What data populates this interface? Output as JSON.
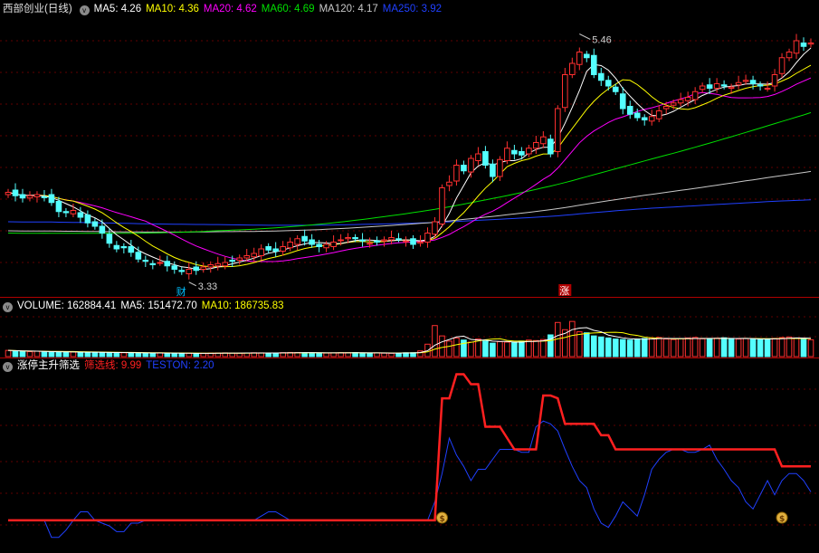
{
  "main": {
    "title": "西部创业(日线)",
    "ma": [
      {
        "label": "MA5: 4.26",
        "color": "#ffffff"
      },
      {
        "label": "MA10: 4.36",
        "color": "#ffff00"
      },
      {
        "label": "MA20: 4.62",
        "color": "#ff00ff"
      },
      {
        "label": "MA60: 4.69",
        "color": "#00e000"
      },
      {
        "label": "MA120: 4.17",
        "color": "#c8c8c8"
      },
      {
        "label": "MA250: 3.92",
        "color": "#2040ff"
      }
    ],
    "high_label": "5.46",
    "low_label": "3.33",
    "marker_cai": "财",
    "marker_zhang": "涨"
  },
  "volume": {
    "items": [
      {
        "label": "VOLUME: 162884.41",
        "color": "#ffffff"
      },
      {
        "label": "MA5: 151472.70",
        "color": "#ffffff"
      },
      {
        "label": "MA10: 186735.83",
        "color": "#ffff00"
      }
    ]
  },
  "indicator": {
    "items": [
      {
        "label": "涨停主升筛选",
        "color": "#ffffff"
      },
      {
        "label": "筛选线: 9.99",
        "color": "#ff2020"
      },
      {
        "label": "TESTON: 2.20",
        "color": "#2040ff"
      }
    ]
  },
  "chart_data": [
    {
      "type": "candlestick",
      "title": "西部创业(日线)",
      "ylim": [
        3.2,
        5.6
      ],
      "x": [
        1,
        2,
        3,
        4,
        5,
        6,
        7,
        8,
        9,
        10,
        11,
        12,
        13,
        14,
        15,
        16,
        17,
        18,
        19,
        20,
        21,
        22,
        23,
        24,
        25,
        26,
        27,
        28,
        29,
        30,
        31,
        32,
        33,
        34,
        35,
        36,
        37,
        38,
        39,
        40,
        41,
        42,
        43,
        44,
        45,
        46,
        47,
        48,
        49,
        50,
        51,
        52,
        53,
        54,
        55,
        56,
        57,
        58,
        59,
        60,
        61,
        62,
        63,
        64,
        65,
        66,
        67,
        68,
        69,
        70,
        71,
        72,
        73,
        74,
        75,
        76,
        77,
        78,
        79,
        80,
        81,
        82,
        83,
        84,
        85,
        86,
        87,
        88,
        89,
        90,
        91,
        92,
        93,
        94,
        95,
        96,
        97,
        98,
        99,
        100,
        101,
        102,
        103,
        104,
        105,
        106,
        107,
        108,
        109,
        110,
        111,
        112
      ],
      "close": [
        4.06,
        4.03,
        4.01,
        4.03,
        4.04,
        4.02,
        3.97,
        3.89,
        3.88,
        3.9,
        3.84,
        3.79,
        3.76,
        3.7,
        3.61,
        3.56,
        3.57,
        3.53,
        3.47,
        3.45,
        3.42,
        3.44,
        3.41,
        3.38,
        3.36,
        3.38,
        3.37,
        3.4,
        3.42,
        3.43,
        3.44,
        3.45,
        3.48,
        3.5,
        3.52,
        3.56,
        3.55,
        3.54,
        3.58,
        3.62,
        3.65,
        3.63,
        3.6,
        3.58,
        3.6,
        3.62,
        3.64,
        3.66,
        3.65,
        3.63,
        3.61,
        3.62,
        3.64,
        3.66,
        3.65,
        3.63,
        3.6,
        3.62,
        3.7,
        3.8,
        4.1,
        4.15,
        4.3,
        4.25,
        4.36,
        4.4,
        4.3,
        4.2,
        4.35,
        4.45,
        4.4,
        4.39,
        4.45,
        4.5,
        4.55,
        4.4,
        4.8,
        5.1,
        5.2,
        5.3,
        5.25,
        5.1,
        5.05,
        5.0,
        4.95,
        4.8,
        4.75,
        4.72,
        4.7,
        4.73,
        4.78,
        4.82,
        4.85,
        4.88,
        4.9,
        4.95,
        5.0,
        4.98,
        5.02,
        5.0,
        4.99,
        5.03,
        5.05,
        5.02,
        5.0,
        4.98,
        5.1,
        5.25,
        5.3,
        5.4,
        5.35,
        5.38
      ],
      "high_marker": 5.46,
      "low_marker": 3.33,
      "moving_averages": [
        {
          "name": "MA5",
          "last": 4.26
        },
        {
          "name": "MA10",
          "last": 4.36
        },
        {
          "name": "MA20",
          "last": 4.62
        },
        {
          "name": "MA60",
          "last": 4.69
        },
        {
          "name": "MA120",
          "last": 4.17
        },
        {
          "name": "MA250",
          "last": 3.92
        }
      ]
    },
    {
      "type": "bar",
      "title": "VOLUME",
      "ylim": [
        0,
        420000
      ],
      "values": [
        60000,
        55000,
        50000,
        48000,
        52000,
        45000,
        46000,
        44000,
        43000,
        45000,
        42000,
        40000,
        41000,
        39000,
        38000,
        40000,
        37000,
        36000,
        35000,
        34000,
        33000,
        36000,
        34000,
        32000,
        31000,
        33000,
        30000,
        32000,
        34000,
        35000,
        36000,
        34000,
        33000,
        35000,
        37000,
        36000,
        34000,
        35000,
        38000,
        40000,
        39000,
        37000,
        36000,
        35000,
        34000,
        36000,
        38000,
        37000,
        39000,
        35000,
        34000,
        36000,
        33000,
        32000,
        35000,
        37000,
        38000,
        55000,
        120000,
        300000,
        200000,
        150000,
        180000,
        160000,
        140000,
        170000,
        150000,
        130000,
        145000,
        140000,
        135000,
        150000,
        160000,
        155000,
        165000,
        210000,
        330000,
        260000,
        340000,
        240000,
        230000,
        200000,
        190000,
        180000,
        170000,
        165000,
        160000,
        170000,
        175000,
        180000,
        185000,
        170000,
        165000,
        175000,
        180000,
        185000,
        172000,
        168000,
        178000,
        182000,
        176000,
        170000,
        174000,
        168000,
        166000,
        172000,
        176000,
        184000,
        190000,
        178000,
        170000,
        162884
      ],
      "up_color": "#ff3030",
      "down_color": "#54ffff",
      "ma_labels": {
        "MA5": 151472.7,
        "MA10": 186735.83,
        "VOLUME": 162884.41
      }
    },
    {
      "type": "line",
      "title": "涨停主升筛选",
      "ylim": [
        0,
        12
      ],
      "series": [
        {
          "name": "筛选线",
          "color": "#ff2020",
          "values": [
            0.2,
            0.2,
            0.2,
            0.2,
            0.2,
            0.2,
            0.2,
            0.2,
            0.2,
            0.2,
            0.2,
            0.2,
            0.2,
            0.2,
            0.2,
            0.2,
            0.2,
            0.2,
            0.2,
            0.2,
            0.2,
            0.2,
            0.2,
            0.2,
            0.2,
            0.2,
            0.2,
            0.2,
            0.2,
            0.2,
            0.2,
            0.2,
            0.2,
            0.2,
            0.2,
            0.2,
            0.2,
            0.2,
            0.2,
            0.2,
            0.2,
            0.2,
            0.2,
            0.2,
            0.2,
            0.2,
            0.2,
            0.2,
            0.2,
            0.2,
            0.2,
            0.2,
            0.2,
            0.2,
            0.2,
            0.2,
            0.2,
            0.2,
            0.2,
            0.2,
            8.8,
            8.8,
            10.5,
            10.5,
            9.8,
            9.8,
            6.8,
            6.8,
            6.8,
            6.0,
            5.2,
            5.2,
            5.2,
            5.2,
            9.0,
            9.0,
            8.8,
            7.0,
            7.0,
            7.0,
            7.0,
            7.0,
            6.2,
            6.2,
            5.2,
            5.2,
            5.2,
            5.2,
            5.2,
            5.2,
            5.2,
            5.2,
            5.2,
            5.2,
            5.2,
            5.2,
            5.2,
            5.2,
            5.2,
            5.2,
            5.2,
            5.2,
            5.2,
            5.2,
            5.2,
            5.2,
            5.2,
            4.0,
            4.0,
            4.0,
            4.0,
            4.0
          ]
        },
        {
          "name": "TESTON",
          "color": "#2040ff",
          "values": [
            0.2,
            0.2,
            0.2,
            0.2,
            0.2,
            0.2,
            -1.0,
            -1.0,
            -0.5,
            0.2,
            0.8,
            0.8,
            0.2,
            0.0,
            -0.2,
            -0.6,
            -0.6,
            0.0,
            0.0,
            0.2,
            0.2,
            0.2,
            0.2,
            0.2,
            0.2,
            0.2,
            0.2,
            0.2,
            0.2,
            0.2,
            0.2,
            0.2,
            0.2,
            0.2,
            0.2,
            0.5,
            0.8,
            0.8,
            0.5,
            0.2,
            0.2,
            0.2,
            0.2,
            0.2,
            0.2,
            0.2,
            0.2,
            0.2,
            0.2,
            0.2,
            0.2,
            0.2,
            0.2,
            0.2,
            0.2,
            0.2,
            0.2,
            0.2,
            0.2,
            1.5,
            3.5,
            6.0,
            4.8,
            4.0,
            3.0,
            3.8,
            3.8,
            4.5,
            5.2,
            5.2,
            5.2,
            5.0,
            5.0,
            6.8,
            7.2,
            7.0,
            6.5,
            5.2,
            4.0,
            3.0,
            2.5,
            1.0,
            0.0,
            -0.3,
            0.5,
            1.5,
            1.0,
            0.5,
            2.0,
            3.8,
            4.5,
            5.0,
            5.2,
            5.2,
            5.0,
            5.0,
            5.2,
            5.5,
            4.5,
            3.8,
            3.0,
            2.5,
            1.5,
            1.0,
            2.0,
            3.0,
            2.0,
            3.0,
            3.5,
            3.5,
            3.0,
            2.2
          ]
        }
      ]
    }
  ]
}
